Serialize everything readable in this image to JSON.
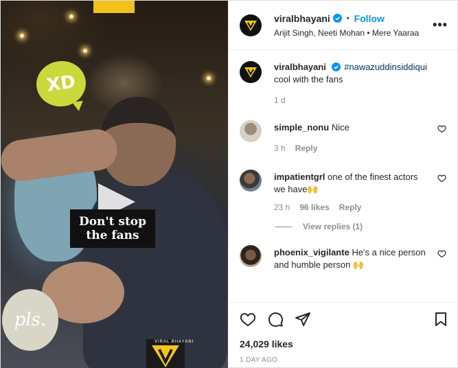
{
  "media": {
    "sign_text": "",
    "sticker_top": "XD",
    "sticker_bottom": "pls.",
    "caption_line1": "Don't stop",
    "caption_line2": "the fans",
    "watermark_text": "VIRAL BHAYANI"
  },
  "header": {
    "username": "viralbhayani",
    "follow_label": "Follow",
    "separator": "•",
    "audio": "Arijit Singh, Neeti Mohan • Mere Yaaraa",
    "more_label": "•••"
  },
  "post_caption": {
    "username": "viralbhayani",
    "hashtag": "#nawazuddinsiddiqui",
    "text": "cool with the fans",
    "time": "1 d"
  },
  "comments": [
    {
      "username": "simple_nonu",
      "text": "Nice",
      "time": "3 h",
      "likes": "",
      "reply_label": "Reply"
    },
    {
      "username": "impatientgrl",
      "text": "one of the finest actors we have🙌",
      "time": "23 h",
      "likes": "96 likes",
      "reply_label": "Reply"
    },
    {
      "username": "phoenix_vigilante",
      "text": "He's a nice person and humble person 🙌",
      "time": "",
      "likes": "",
      "reply_label": ""
    }
  ],
  "view_replies_label": "View replies (1)",
  "footer": {
    "likes": "24,029 likes",
    "date": "1 DAY AGO"
  },
  "colors": {
    "accent": "#0095f6",
    "hashtag": "#00376b",
    "muted": "#8e8e8e",
    "brand_yellow": "#f5c518"
  },
  "icons": {
    "verified": "verified-badge-icon",
    "like": "heart-icon",
    "comment": "comment-icon",
    "share": "share-icon",
    "save": "bookmark-icon",
    "play": "play-icon"
  }
}
